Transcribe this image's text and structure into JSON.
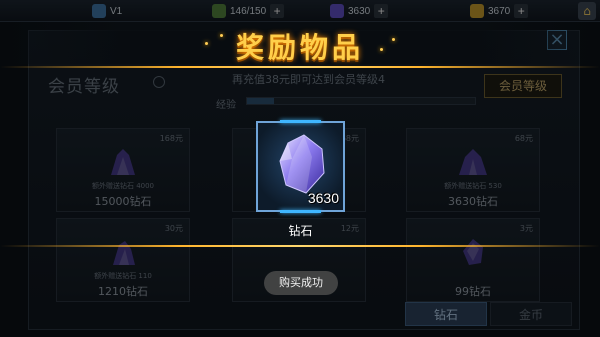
{
  "topbar": {
    "player": "V1",
    "stamina": "146/150",
    "diamonds": "3630",
    "gold": "3670",
    "plus": "+"
  },
  "shop": {
    "close_icon": "×",
    "vip_title": "会员等级",
    "vip_progress": "再充值38元即可达到会员等级4",
    "exp_label": "经验",
    "exp_fraction": 0.12,
    "vip_button": "会员等级",
    "cards": [
      {
        "price": "168元",
        "bonus": "额外赠送钻石 4000",
        "amount": "15000钻石"
      },
      {
        "price": "68元",
        "bonus": "",
        "amount": ""
      },
      {
        "price": "68元",
        "bonus": "额外赠送钻石 530",
        "amount": "3630钻石"
      },
      {
        "price": "30元",
        "bonus": "额外赠送钻石 110",
        "amount": "1210钻石"
      },
      {
        "price": "12元",
        "bonus": "",
        "amount": ""
      },
      {
        "price": "3元",
        "bonus": "",
        "amount": "99钻石"
      }
    ],
    "tabs": [
      "钻石",
      "金币"
    ]
  },
  "reward": {
    "title": "奖励物品",
    "item_name": "钻石",
    "item_count": "3630",
    "toast": "购买成功"
  },
  "colors": {
    "title_gold": "#ffcf4a",
    "frame_blue": "#6fa4d8",
    "gem_purple": "#6a4fd0"
  }
}
